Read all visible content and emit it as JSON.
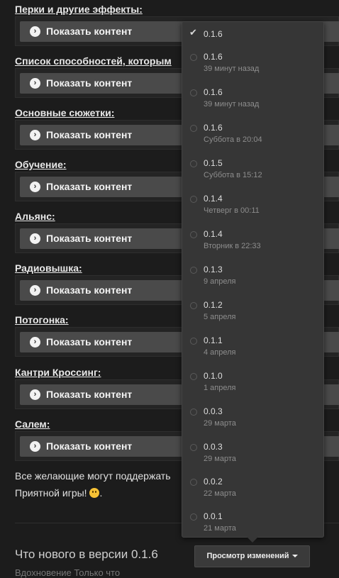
{
  "sections": [
    {
      "title": "Перки и другие эффекты:"
    },
    {
      "title": "Список способностей, которым"
    },
    {
      "title": "Основные сюжетки:"
    },
    {
      "title": "Обучение:"
    },
    {
      "title": "Альянс:"
    },
    {
      "title": "Радиовышка:"
    },
    {
      "title": "Потогонка:"
    },
    {
      "title": "Кантри Кроссинг:"
    },
    {
      "title": "Салем:"
    }
  ],
  "spoiler_label": "Показать контент",
  "support_text": "Все желающие могут поддержать",
  "thanks_text": "Приятной игры!",
  "thanks_suffix": ".",
  "whats_new": "Что нового в версии 0.1.6",
  "view_changes_button": "Просмотр изменений",
  "bottom_text": "Вдохновение Только что",
  "versions": [
    {
      "version": "0.1.6",
      "date": "",
      "selected": true
    },
    {
      "version": "0.1.6",
      "date": "39 минут назад"
    },
    {
      "version": "0.1.6",
      "date": "39 минут назад"
    },
    {
      "version": "0.1.6",
      "date": "Суббота в 20:04"
    },
    {
      "version": "0.1.5",
      "date": "Суббота в 15:12"
    },
    {
      "version": "0.1.4",
      "date": "Четверг в 00:11"
    },
    {
      "version": "0.1.4",
      "date": "Вторник в 22:33"
    },
    {
      "version": "0.1.3",
      "date": "9 апреля"
    },
    {
      "version": "0.1.2",
      "date": "5 апреля"
    },
    {
      "version": "0.1.1",
      "date": "4 апреля"
    },
    {
      "version": "0.1.0",
      "date": "1 апреля"
    },
    {
      "version": "0.0.3",
      "date": "29 марта"
    },
    {
      "version": "0.0.3",
      "date": "29 марта"
    },
    {
      "version": "0.0.2",
      "date": "22 марта"
    },
    {
      "version": "0.0.1",
      "date": "21 марта"
    }
  ]
}
